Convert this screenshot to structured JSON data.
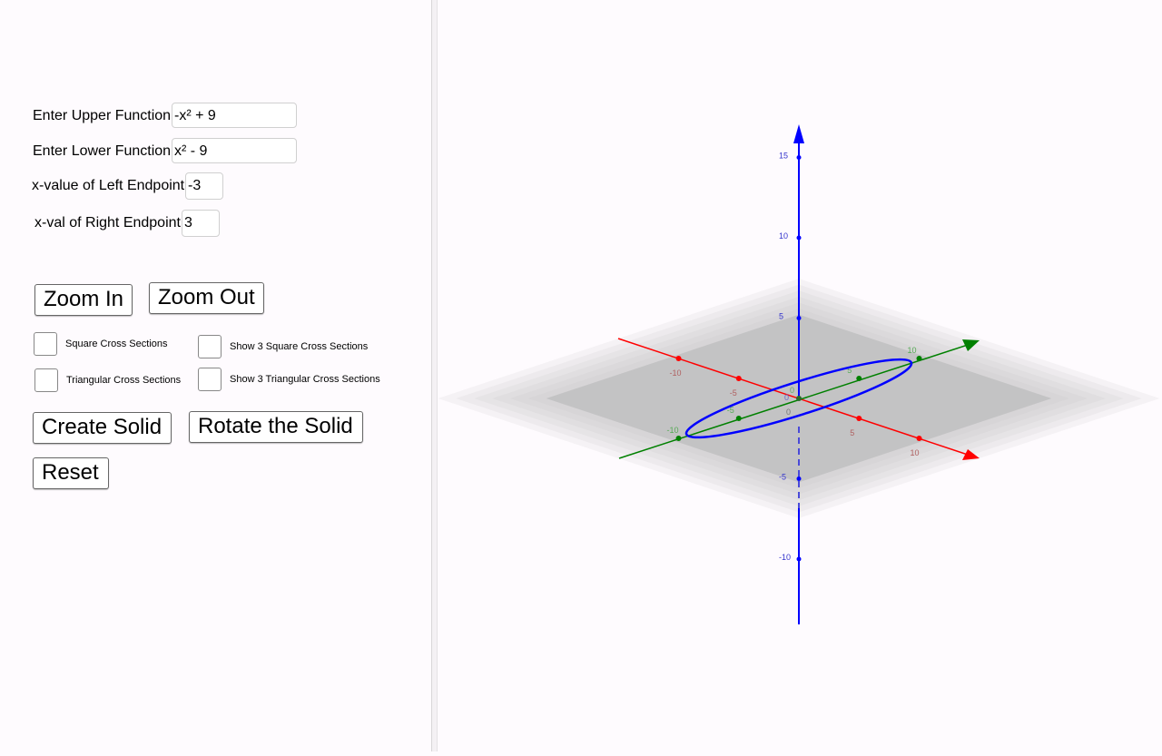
{
  "inputs": {
    "upper": {
      "label": "Enter Upper Function",
      "value": "-x² + 9"
    },
    "lower": {
      "label": "Enter Lower Function",
      "value": "x² - 9"
    },
    "left": {
      "label": "x-value of Left Endpoint",
      "value": "-3"
    },
    "right": {
      "label": "x-val of Right Endpoint",
      "value": "3"
    }
  },
  "buttons": {
    "zoom_in": "Zoom In",
    "zoom_out": "Zoom Out",
    "create_solid": "Create Solid",
    "rotate_solid": "Rotate the Solid",
    "reset": "Reset"
  },
  "checkboxes": [
    {
      "label": "Square Cross Sections",
      "checked": false
    },
    {
      "label": "Show 3 Square Cross Sections",
      "checked": false
    },
    {
      "label": "Triangular Cross Sections",
      "checked": false
    },
    {
      "label": "Show 3 Triangular Cross Sections",
      "checked": false
    }
  ],
  "view3d": {
    "colors": {
      "x_axis": "#ff0000",
      "y_axis": "#008000",
      "z_axis": "#0000ff",
      "curve": "#0000ff",
      "plane": "#c0bfc1"
    },
    "x_ticks": [
      "-10",
      "-5",
      "0",
      "5",
      "10"
    ],
    "y_ticks": [
      "-10",
      "-5",
      "0",
      "5",
      "10"
    ],
    "z_ticks": [
      "15",
      "10",
      "5",
      "0",
      "-5",
      "-10"
    ]
  }
}
